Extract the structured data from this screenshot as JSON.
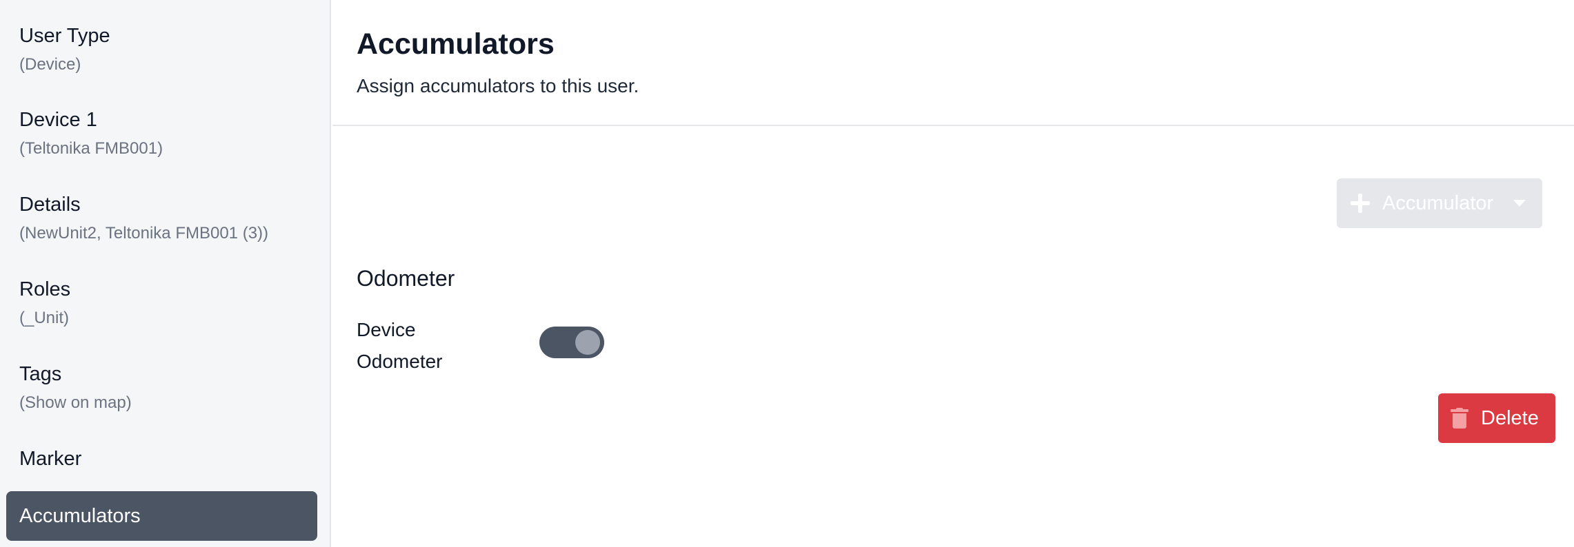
{
  "sidebar": {
    "items": [
      {
        "title": "User Type",
        "subtitle": "(Device)"
      },
      {
        "title": "Device 1",
        "subtitle": "(Teltonika FMB001)"
      },
      {
        "title": "Details",
        "subtitle": "(NewUnit2, Teltonika FMB001 (3))"
      },
      {
        "title": "Roles",
        "subtitle": "(_Unit)"
      },
      {
        "title": "Tags",
        "subtitle": "(Show on map)"
      },
      {
        "title": "Marker",
        "subtitle": ""
      },
      {
        "title": "Accumulators",
        "subtitle": "",
        "active": true
      }
    ]
  },
  "main": {
    "title": "Accumulators",
    "description": "Assign accumulators to this user.",
    "add_button_label": "Accumulator",
    "section_title": "Odometer",
    "field_label": "Device Odometer",
    "toggle_on": true,
    "delete_label": "Delete"
  },
  "icons": {
    "add": "plus-icon",
    "dropdown": "chevron-down-icon",
    "delete": "trash-icon"
  },
  "colors": {
    "sidebar_bg": "#f5f6f8",
    "active_item_bg": "#4b5563",
    "delete_bg": "#dc3a42",
    "disabled_button_bg": "#e5e7eb"
  }
}
